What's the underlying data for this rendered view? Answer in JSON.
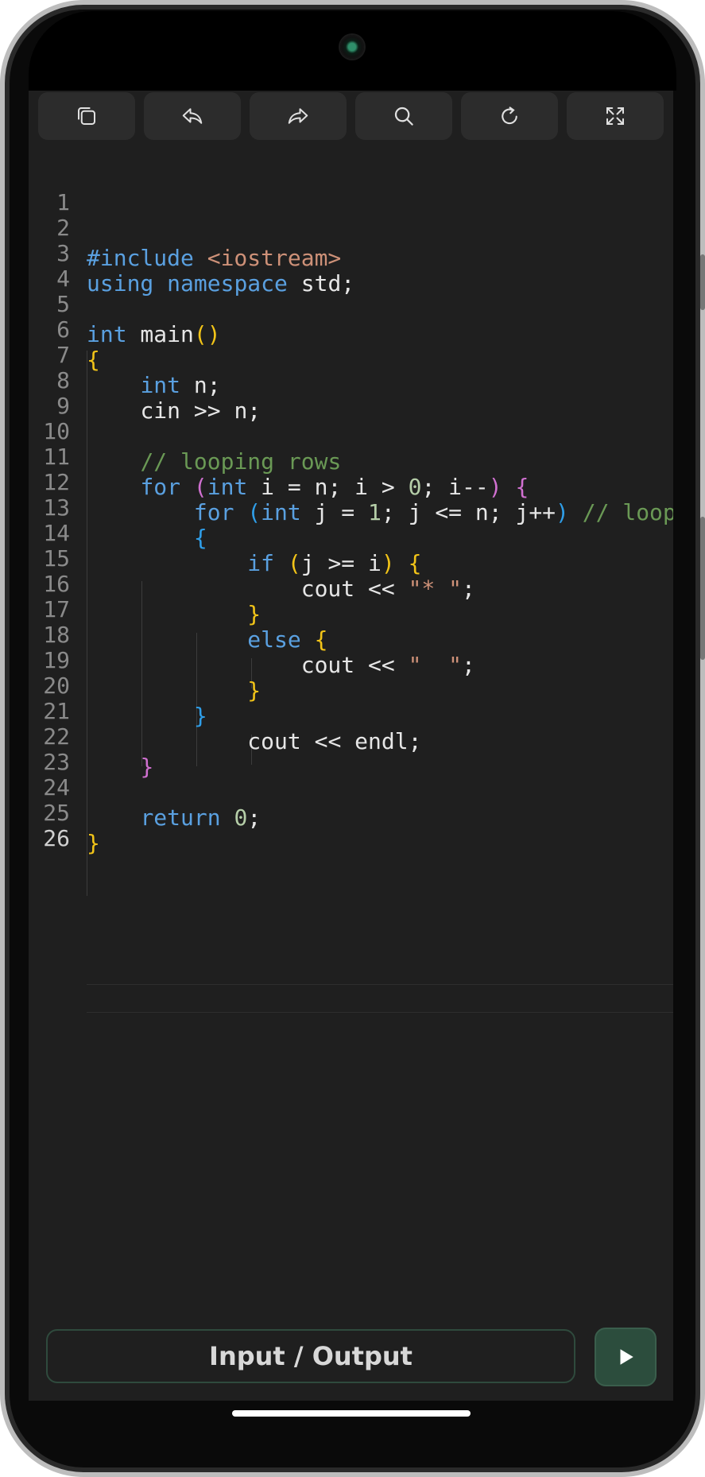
{
  "toolbar": {
    "icons": [
      "copy-icon",
      "undo-icon",
      "redo-icon",
      "search-icon",
      "refresh-icon",
      "fullscreen-icon"
    ]
  },
  "editor": {
    "line_numbers": [
      "1",
      "2",
      "3",
      "4",
      "5",
      "6",
      "7",
      "8",
      "9",
      "10",
      "11",
      "12",
      "13",
      "14",
      "15",
      "16",
      "17",
      "18",
      "19",
      "20",
      "21",
      "22",
      "23",
      "24",
      "25",
      "26"
    ],
    "code": {
      "l2_include": "#include",
      "l2_header": "<iostream>",
      "l3_using": "using",
      "l3_namespace": "namespace",
      "l3_rest": " std;",
      "l5_int": "int",
      "l5_main": " main",
      "l5_parens": "()",
      "l6_brace": "{",
      "l7_int": "int",
      "l7_rest": " n;",
      "l8_text": "cin >> n;",
      "l10_comment": "// looping rows",
      "l11_for": "for",
      "l11_paren_open": "(",
      "l11_int": "int",
      "l11_mid1": " i = n; i > ",
      "l11_zero": "0",
      "l11_mid2": "; i--",
      "l11_paren_close": ")",
      "l11_brace": "{",
      "l12_for": "for",
      "l12_paren_open": "(",
      "l12_int": "int",
      "l12_mid1": " j = ",
      "l12_one": "1",
      "l12_mid2": "; j <= n; j++",
      "l12_paren_close": ")",
      "l12_comment": "// looping columns",
      "l13_brace": "{",
      "l14_if": "if",
      "l14_paren_open": "(",
      "l14_mid": "j >= i",
      "l14_paren_close": ")",
      "l14_brace": "{",
      "l15_cout": "cout << ",
      "l15_str": "\"* \"",
      "l15_semi": ";",
      "l16_brace": "}",
      "l17_else": "else",
      "l17_brace": "{",
      "l18_cout": "cout << ",
      "l18_str": "\"  \"",
      "l18_semi": ";",
      "l19_brace": "}",
      "l20_brace": "}",
      "l21_text": "cout << endl;",
      "l22_brace": "}",
      "l24_return": "return",
      "l24_zero": "0",
      "l24_semi": ";",
      "l25_brace": "}"
    }
  },
  "bottom": {
    "io_label": "Input / Output",
    "run_icon": "play-icon"
  },
  "colors": {
    "keyword": "#5aa0e0",
    "string": "#ce9178",
    "number": "#b5cea8",
    "comment": "#6a9955",
    "bracket_1": "#f2c418",
    "bracket_2": "#d070d0",
    "bracket_3": "#2f9ee8",
    "run_button": "#2c4d3d"
  }
}
